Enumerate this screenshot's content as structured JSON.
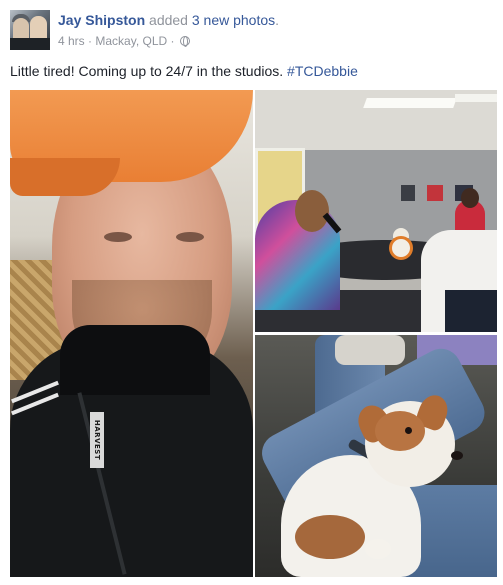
{
  "post": {
    "author": "Jay Shipston",
    "action_prefix": "added",
    "action_link": "3 new photos",
    "action_suffix": ".",
    "time": "4 hrs",
    "separator": " · ",
    "location": "Mackay, QLD",
    "privacy_separator": " · ",
    "privacy_icon": "globe-icon",
    "caption": "Little tired! Coming up to 24/7 in the studios. ",
    "hashtag": "#TCDebbie"
  },
  "photos": [
    {
      "subject": "selfie",
      "jacket_tag": "HARVEST"
    },
    {
      "subject": "studio"
    },
    {
      "subject": "dog"
    }
  ],
  "colors": {
    "link": "#365899",
    "meta_text": "#90949c",
    "body_text": "#1d2129"
  }
}
